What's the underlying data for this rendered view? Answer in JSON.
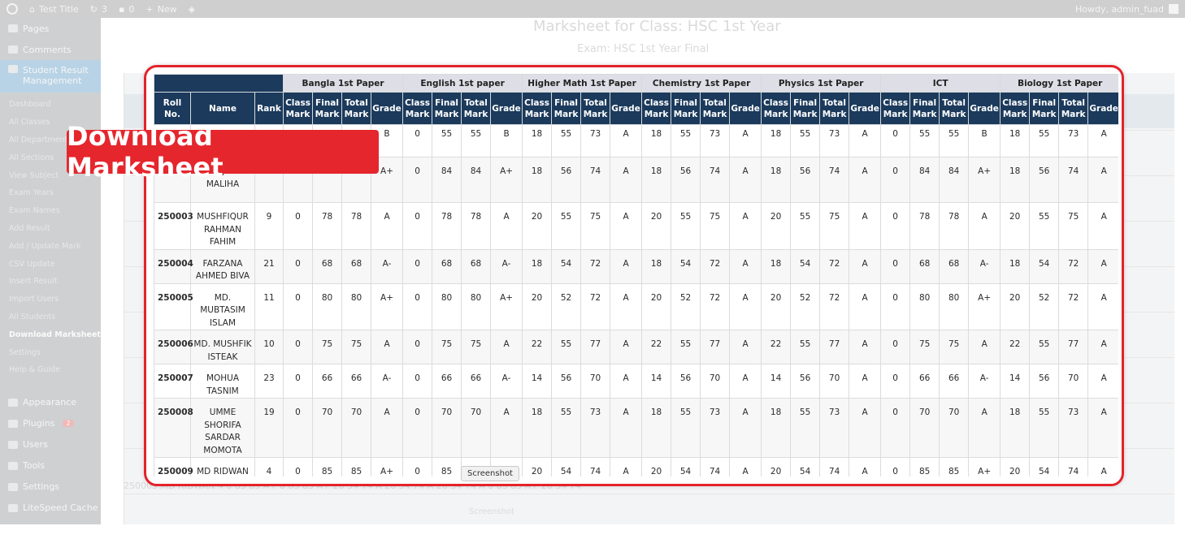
{
  "adminbar": {
    "site_title": "Test Title",
    "updates_count": "3",
    "comments_count": "0",
    "new_label": "New",
    "howdy": "Howdy, admin_fuad"
  },
  "sidebar": {
    "items": [
      {
        "label": "Pages",
        "icon": "pages-icon"
      },
      {
        "label": "Comments",
        "icon": "comments-icon"
      },
      {
        "label": "Student Result Management",
        "icon": "graduation-cap-icon"
      }
    ],
    "submenu": [
      "Dashboard",
      "All Classes",
      "All Departments",
      "All Sections",
      "View Subject",
      "Exam Years",
      "Exam Names",
      "Add Result",
      "Add / Update Mark",
      "CSV Update",
      "Insert Result",
      "Import Users",
      "All Students",
      "Download Marksheet",
      "Settings",
      "Help & Guide"
    ],
    "bottom_items": [
      {
        "label": "Appearance",
        "icon": "appearance-icon"
      },
      {
        "label": "Plugins",
        "icon": "plugins-icon",
        "badge": "2"
      },
      {
        "label": "Users",
        "icon": "users-icon"
      },
      {
        "label": "Tools",
        "icon": "tools-icon"
      },
      {
        "label": "Settings",
        "icon": "settings-icon"
      },
      {
        "label": "LiteSpeed Cache",
        "icon": "litespeed-icon"
      }
    ]
  },
  "page": {
    "title": "Marksheet for Class: HSC 1st Year",
    "exam": "Exam: HSC 1st Year Final"
  },
  "banner": "Download Marksheet",
  "tooltip": "Screenshot",
  "ghost_row": "250009   MD RIDWAN   4   0   85   85   A+   0   85   85   A+   20   54   74   A   20   54   74   A   20   54   74   A   0   85   85   A+   20   54   74",
  "ghost_tooltip": "Screenshot",
  "table": {
    "headers": {
      "roll": "Roll No.",
      "name": "Name",
      "rank": "Rank"
    },
    "subjects": [
      "Bangla 1st Paper",
      "English 1st paper",
      "Higher Math 1st Paper",
      "Chemistry 1st Paper",
      "Physics 1st Paper",
      "ICT",
      "Biology 1st Paper"
    ],
    "subcols": [
      "Class Mark",
      "Final Mark",
      "Total Mark",
      "Grade"
    ],
    "rows": [
      {
        "roll": "",
        "name": "",
        "rank": "",
        "marks": [
          [
            "",
            "",
            "",
            "B"
          ],
          [
            "0",
            "55",
            "55",
            "B"
          ],
          [
            "18",
            "55",
            "73",
            "A"
          ],
          [
            "18",
            "55",
            "73",
            "A"
          ],
          [
            "18",
            "55",
            "73",
            "A"
          ],
          [
            "0",
            "55",
            "55",
            "B"
          ],
          [
            "18",
            "55",
            "73",
            "A"
          ]
        ]
      },
      {
        "roll": "",
        "name": "MARJUKA MALIHA",
        "rank": "",
        "marks": [
          [
            "",
            "",
            "",
            "A+"
          ],
          [
            "0",
            "84",
            "84",
            "A+"
          ],
          [
            "18",
            "56",
            "74",
            "A"
          ],
          [
            "18",
            "56",
            "74",
            "A"
          ],
          [
            "18",
            "56",
            "74",
            "A"
          ],
          [
            "0",
            "84",
            "84",
            "A+"
          ],
          [
            "18",
            "56",
            "74",
            "A"
          ]
        ]
      },
      {
        "roll": "250003",
        "name": "MUSHFIQUR RAHMAN FAHIM",
        "rank": "9",
        "marks": [
          [
            "0",
            "78",
            "78",
            "A"
          ],
          [
            "0",
            "78",
            "78",
            "A"
          ],
          [
            "20",
            "55",
            "75",
            "A"
          ],
          [
            "20",
            "55",
            "75",
            "A"
          ],
          [
            "20",
            "55",
            "75",
            "A"
          ],
          [
            "0",
            "78",
            "78",
            "A"
          ],
          [
            "20",
            "55",
            "75",
            "A"
          ]
        ]
      },
      {
        "roll": "250004",
        "name": "FARZANA AHMED BIVA",
        "rank": "21",
        "marks": [
          [
            "0",
            "68",
            "68",
            "A-"
          ],
          [
            "0",
            "68",
            "68",
            "A-"
          ],
          [
            "18",
            "54",
            "72",
            "A"
          ],
          [
            "18",
            "54",
            "72",
            "A"
          ],
          [
            "18",
            "54",
            "72",
            "A"
          ],
          [
            "0",
            "68",
            "68",
            "A-"
          ],
          [
            "18",
            "54",
            "72",
            "A"
          ]
        ]
      },
      {
        "roll": "250005",
        "name": "MD. MUBTASIM ISLAM",
        "rank": "11",
        "marks": [
          [
            "0",
            "80",
            "80",
            "A+"
          ],
          [
            "0",
            "80",
            "80",
            "A+"
          ],
          [
            "20",
            "52",
            "72",
            "A"
          ],
          [
            "20",
            "52",
            "72",
            "A"
          ],
          [
            "20",
            "52",
            "72",
            "A"
          ],
          [
            "0",
            "80",
            "80",
            "A+"
          ],
          [
            "20",
            "52",
            "72",
            "A"
          ]
        ]
      },
      {
        "roll": "250006",
        "name": "MD. MUSHFIK ISTEAK",
        "rank": "10",
        "marks": [
          [
            "0",
            "75",
            "75",
            "A"
          ],
          [
            "0",
            "75",
            "75",
            "A"
          ],
          [
            "22",
            "55",
            "77",
            "A"
          ],
          [
            "22",
            "55",
            "77",
            "A"
          ],
          [
            "22",
            "55",
            "77",
            "A"
          ],
          [
            "0",
            "75",
            "75",
            "A"
          ],
          [
            "22",
            "55",
            "77",
            "A"
          ]
        ]
      },
      {
        "roll": "250007",
        "name": "MOHUA TASNIM",
        "rank": "23",
        "marks": [
          [
            "0",
            "66",
            "66",
            "A-"
          ],
          [
            "0",
            "66",
            "66",
            "A-"
          ],
          [
            "14",
            "56",
            "70",
            "A"
          ],
          [
            "14",
            "56",
            "70",
            "A"
          ],
          [
            "14",
            "56",
            "70",
            "A"
          ],
          [
            "0",
            "66",
            "66",
            "A-"
          ],
          [
            "14",
            "56",
            "70",
            "A"
          ]
        ]
      },
      {
        "roll": "250008",
        "name": "UMME SHORIFA SARDAR MOMOTA",
        "rank": "19",
        "marks": [
          [
            "0",
            "70",
            "70",
            "A"
          ],
          [
            "0",
            "70",
            "70",
            "A"
          ],
          [
            "18",
            "55",
            "73",
            "A"
          ],
          [
            "18",
            "55",
            "73",
            "A"
          ],
          [
            "18",
            "55",
            "73",
            "A"
          ],
          [
            "0",
            "70",
            "70",
            "A"
          ],
          [
            "18",
            "55",
            "73",
            "A"
          ]
        ]
      },
      {
        "roll": "250009",
        "name": "MD RIDWAN KABIR",
        "rank": "4",
        "marks": [
          [
            "0",
            "85",
            "85",
            "A+"
          ],
          [
            "0",
            "85",
            "85",
            "A+"
          ],
          [
            "20",
            "54",
            "74",
            "A"
          ],
          [
            "20",
            "54",
            "74",
            "A"
          ],
          [
            "20",
            "54",
            "74",
            "A"
          ],
          [
            "0",
            "85",
            "85",
            "A+"
          ],
          [
            "20",
            "54",
            "74",
            "A"
          ]
        ]
      }
    ]
  },
  "colors": {
    "header_blue": "#1b3a5c",
    "accent_red": "#e4232b"
  }
}
